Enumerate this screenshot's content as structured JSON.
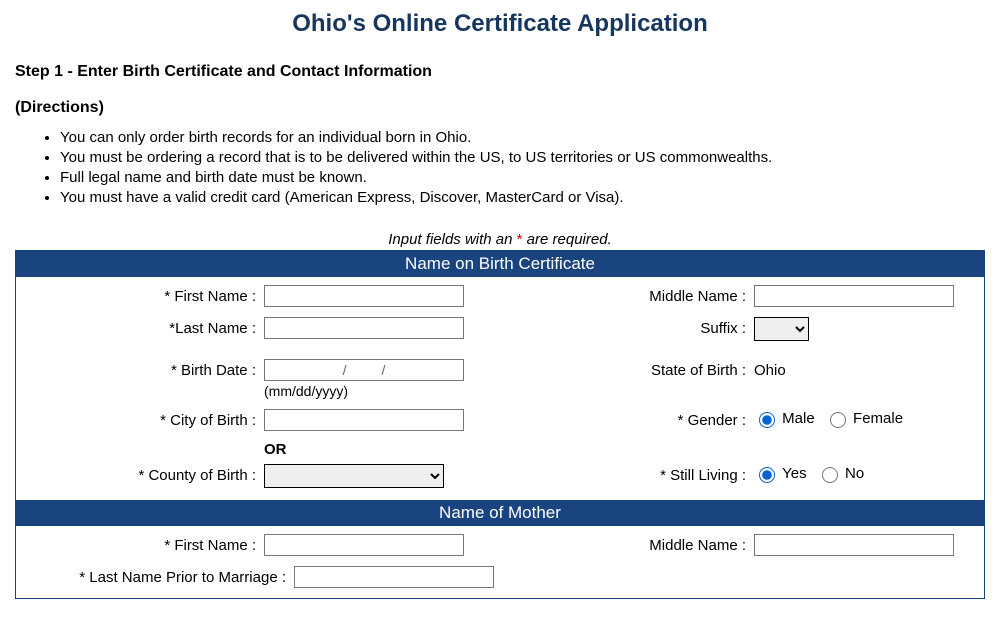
{
  "page": {
    "title": "Ohio's Online Certificate Application",
    "step_title": "Step 1 - Enter Birth Certificate and Contact Information",
    "directions_label": "(Directions)",
    "bullets": [
      "You can only order birth records for an individual born in Ohio.",
      "You must be ordering a record that is to be delivered within the US, to US territories or US commonwealths.",
      "Full legal name and birth date must be known.",
      "You must have a valid credit card (American Express, Discover, MasterCard or Visa)."
    ],
    "required_note_prefix": "Input fields with an ",
    "required_note_suffix": " are required."
  },
  "section1": {
    "header": "Name on Birth Certificate",
    "labels": {
      "first_name": "* First Name :",
      "middle_name": "Middle Name :",
      "last_name": "*Last Name :",
      "suffix": "Suffix :",
      "birth_date": "* Birth Date :",
      "date_hint": "(mm/dd/yyyy)",
      "date_placeholder": "/         /",
      "state_of_birth": "State of Birth :",
      "state_value": "Ohio",
      "city_of_birth": "* City of Birth :",
      "gender": "* Gender :",
      "gender_male": "Male",
      "gender_female": "Female",
      "or": "OR",
      "county_of_birth": "* County of Birth :",
      "still_living": "* Still Living :",
      "yes": "Yes",
      "no": "No"
    }
  },
  "section2": {
    "header": "Name of Mother",
    "labels": {
      "first_name": "* First Name :",
      "middle_name": "Middle Name :",
      "last_name_prior": "* Last Name Prior to Marriage :"
    }
  }
}
